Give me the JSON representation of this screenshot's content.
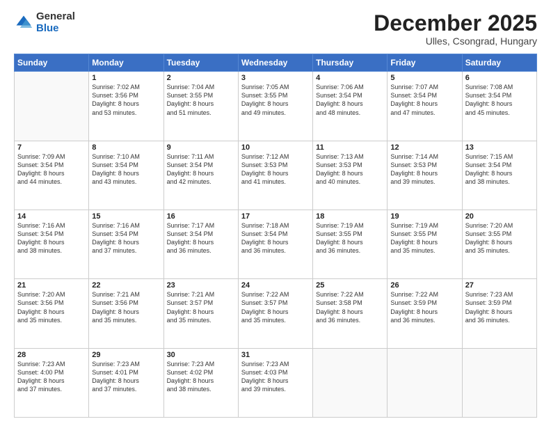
{
  "logo": {
    "general": "General",
    "blue": "Blue"
  },
  "header": {
    "month": "December 2025",
    "location": "Ulles, Csongrad, Hungary"
  },
  "weekdays": [
    "Sunday",
    "Monday",
    "Tuesday",
    "Wednesday",
    "Thursday",
    "Friday",
    "Saturday"
  ],
  "weeks": [
    [
      {
        "day": "",
        "sunrise": "",
        "sunset": "",
        "daylight": ""
      },
      {
        "day": "1",
        "sunrise": "Sunrise: 7:02 AM",
        "sunset": "Sunset: 3:56 PM",
        "daylight": "Daylight: 8 hours and 53 minutes."
      },
      {
        "day": "2",
        "sunrise": "Sunrise: 7:04 AM",
        "sunset": "Sunset: 3:55 PM",
        "daylight": "Daylight: 8 hours and 51 minutes."
      },
      {
        "day": "3",
        "sunrise": "Sunrise: 7:05 AM",
        "sunset": "Sunset: 3:55 PM",
        "daylight": "Daylight: 8 hours and 49 minutes."
      },
      {
        "day": "4",
        "sunrise": "Sunrise: 7:06 AM",
        "sunset": "Sunset: 3:54 PM",
        "daylight": "Daylight: 8 hours and 48 minutes."
      },
      {
        "day": "5",
        "sunrise": "Sunrise: 7:07 AM",
        "sunset": "Sunset: 3:54 PM",
        "daylight": "Daylight: 8 hours and 47 minutes."
      },
      {
        "day": "6",
        "sunrise": "Sunrise: 7:08 AM",
        "sunset": "Sunset: 3:54 PM",
        "daylight": "Daylight: 8 hours and 45 minutes."
      }
    ],
    [
      {
        "day": "7",
        "sunrise": "Sunrise: 7:09 AM",
        "sunset": "Sunset: 3:54 PM",
        "daylight": "Daylight: 8 hours and 44 minutes."
      },
      {
        "day": "8",
        "sunrise": "Sunrise: 7:10 AM",
        "sunset": "Sunset: 3:54 PM",
        "daylight": "Daylight: 8 hours and 43 minutes."
      },
      {
        "day": "9",
        "sunrise": "Sunrise: 7:11 AM",
        "sunset": "Sunset: 3:54 PM",
        "daylight": "Daylight: 8 hours and 42 minutes."
      },
      {
        "day": "10",
        "sunrise": "Sunrise: 7:12 AM",
        "sunset": "Sunset: 3:53 PM",
        "daylight": "Daylight: 8 hours and 41 minutes."
      },
      {
        "day": "11",
        "sunrise": "Sunrise: 7:13 AM",
        "sunset": "Sunset: 3:53 PM",
        "daylight": "Daylight: 8 hours and 40 minutes."
      },
      {
        "day": "12",
        "sunrise": "Sunrise: 7:14 AM",
        "sunset": "Sunset: 3:53 PM",
        "daylight": "Daylight: 8 hours and 39 minutes."
      },
      {
        "day": "13",
        "sunrise": "Sunrise: 7:15 AM",
        "sunset": "Sunset: 3:54 PM",
        "daylight": "Daylight: 8 hours and 38 minutes."
      }
    ],
    [
      {
        "day": "14",
        "sunrise": "Sunrise: 7:16 AM",
        "sunset": "Sunset: 3:54 PM",
        "daylight": "Daylight: 8 hours and 38 minutes."
      },
      {
        "day": "15",
        "sunrise": "Sunrise: 7:16 AM",
        "sunset": "Sunset: 3:54 PM",
        "daylight": "Daylight: 8 hours and 37 minutes."
      },
      {
        "day": "16",
        "sunrise": "Sunrise: 7:17 AM",
        "sunset": "Sunset: 3:54 PM",
        "daylight": "Daylight: 8 hours and 36 minutes."
      },
      {
        "day": "17",
        "sunrise": "Sunrise: 7:18 AM",
        "sunset": "Sunset: 3:54 PM",
        "daylight": "Daylight: 8 hours and 36 minutes."
      },
      {
        "day": "18",
        "sunrise": "Sunrise: 7:19 AM",
        "sunset": "Sunset: 3:55 PM",
        "daylight": "Daylight: 8 hours and 36 minutes."
      },
      {
        "day": "19",
        "sunrise": "Sunrise: 7:19 AM",
        "sunset": "Sunset: 3:55 PM",
        "daylight": "Daylight: 8 hours and 35 minutes."
      },
      {
        "day": "20",
        "sunrise": "Sunrise: 7:20 AM",
        "sunset": "Sunset: 3:55 PM",
        "daylight": "Daylight: 8 hours and 35 minutes."
      }
    ],
    [
      {
        "day": "21",
        "sunrise": "Sunrise: 7:20 AM",
        "sunset": "Sunset: 3:56 PM",
        "daylight": "Daylight: 8 hours and 35 minutes."
      },
      {
        "day": "22",
        "sunrise": "Sunrise: 7:21 AM",
        "sunset": "Sunset: 3:56 PM",
        "daylight": "Daylight: 8 hours and 35 minutes."
      },
      {
        "day": "23",
        "sunrise": "Sunrise: 7:21 AM",
        "sunset": "Sunset: 3:57 PM",
        "daylight": "Daylight: 8 hours and 35 minutes."
      },
      {
        "day": "24",
        "sunrise": "Sunrise: 7:22 AM",
        "sunset": "Sunset: 3:57 PM",
        "daylight": "Daylight: 8 hours and 35 minutes."
      },
      {
        "day": "25",
        "sunrise": "Sunrise: 7:22 AM",
        "sunset": "Sunset: 3:58 PM",
        "daylight": "Daylight: 8 hours and 36 minutes."
      },
      {
        "day": "26",
        "sunrise": "Sunrise: 7:22 AM",
        "sunset": "Sunset: 3:59 PM",
        "daylight": "Daylight: 8 hours and 36 minutes."
      },
      {
        "day": "27",
        "sunrise": "Sunrise: 7:23 AM",
        "sunset": "Sunset: 3:59 PM",
        "daylight": "Daylight: 8 hours and 36 minutes."
      }
    ],
    [
      {
        "day": "28",
        "sunrise": "Sunrise: 7:23 AM",
        "sunset": "Sunset: 4:00 PM",
        "daylight": "Daylight: 8 hours and 37 minutes."
      },
      {
        "day": "29",
        "sunrise": "Sunrise: 7:23 AM",
        "sunset": "Sunset: 4:01 PM",
        "daylight": "Daylight: 8 hours and 37 minutes."
      },
      {
        "day": "30",
        "sunrise": "Sunrise: 7:23 AM",
        "sunset": "Sunset: 4:02 PM",
        "daylight": "Daylight: 8 hours and 38 minutes."
      },
      {
        "day": "31",
        "sunrise": "Sunrise: 7:23 AM",
        "sunset": "Sunset: 4:03 PM",
        "daylight": "Daylight: 8 hours and 39 minutes."
      },
      {
        "day": "",
        "sunrise": "",
        "sunset": "",
        "daylight": ""
      },
      {
        "day": "",
        "sunrise": "",
        "sunset": "",
        "daylight": ""
      },
      {
        "day": "",
        "sunrise": "",
        "sunset": "",
        "daylight": ""
      }
    ]
  ]
}
